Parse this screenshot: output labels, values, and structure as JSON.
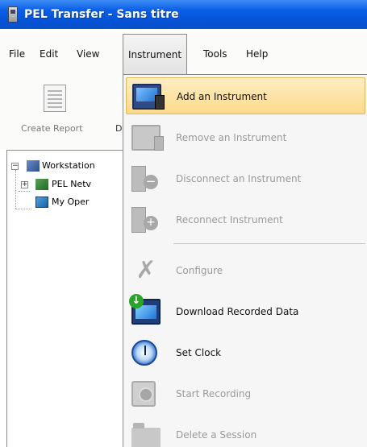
{
  "window": {
    "title": "PEL Transfer - Sans titre",
    "app_icon": "pel-device-icon"
  },
  "menubar": {
    "items": [
      {
        "label": "File"
      },
      {
        "label": "Edit"
      },
      {
        "label": "View"
      },
      {
        "label": "Instrument",
        "active": true
      },
      {
        "label": "Tools"
      },
      {
        "label": "Help"
      }
    ]
  },
  "toolbar": {
    "create_report_label": "Create Report",
    "next_label_fragment": "D",
    "create_report_icon": "report-icon"
  },
  "tree": {
    "root": {
      "label": "Workstation",
      "icon": "workstation-icon",
      "expander": "−"
    },
    "children": [
      {
        "label": "PEL Netv",
        "icon": "network-icon",
        "expander": "+"
      },
      {
        "label": "My Oper",
        "icon": "operations-icon"
      }
    ]
  },
  "instrument_menu": {
    "items": [
      {
        "label": "Add an Instrument",
        "icon": "add-instrument-icon",
        "enabled": true,
        "highlighted": true
      },
      {
        "label": "Remove an Instrument",
        "icon": "remove-instrument-icon",
        "enabled": false
      },
      {
        "label": "Disconnect an Instrument",
        "icon": "disconnect-instrument-icon",
        "enabled": false
      },
      {
        "label": "Reconnect Instrument",
        "icon": "reconnect-instrument-icon",
        "enabled": false
      },
      {
        "label": "Configure",
        "icon": "configure-tools-icon",
        "enabled": false
      },
      {
        "label": "Download Recorded Data",
        "icon": "download-data-icon",
        "enabled": true
      },
      {
        "label": "Set Clock",
        "icon": "clock-icon",
        "enabled": true
      },
      {
        "label": "Start Recording",
        "icon": "start-recording-icon",
        "enabled": false
      },
      {
        "label": "Delete a Session",
        "icon": "delete-session-icon",
        "enabled": false
      }
    ]
  },
  "colors": {
    "titlebar": "#0553d8",
    "highlight": "#fbd98a",
    "disabled_text": "#9a9a9a"
  }
}
